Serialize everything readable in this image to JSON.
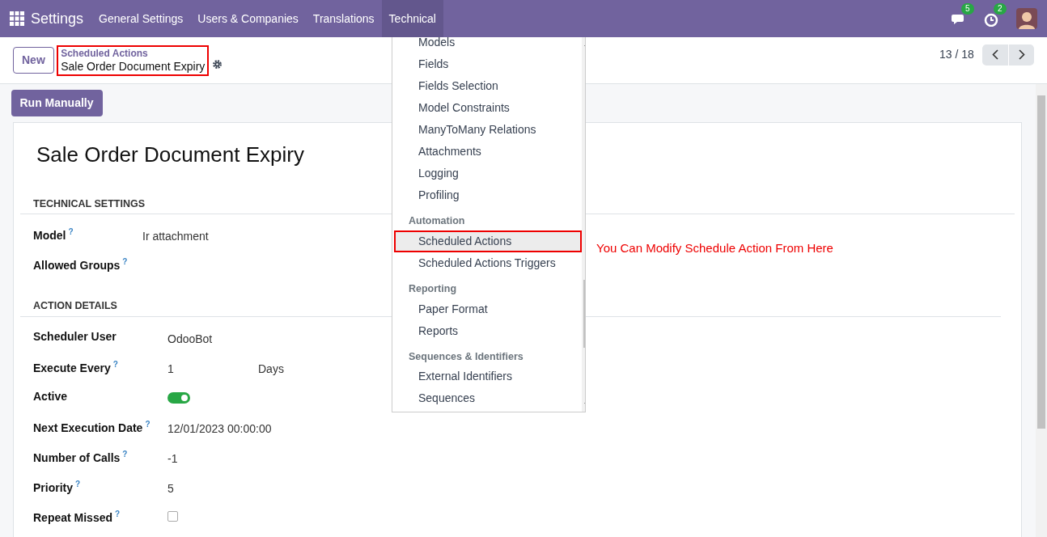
{
  "navbar": {
    "app": "Settings",
    "menus": [
      {
        "label": "General Settings",
        "selected": false
      },
      {
        "label": "Users & Companies",
        "selected": false
      },
      {
        "label": "Translations",
        "selected": false
      },
      {
        "label": "Technical",
        "selected": true
      }
    ],
    "indicators": [
      {
        "kind": "messages",
        "count": "5"
      },
      {
        "kind": "activities",
        "count": "2"
      }
    ]
  },
  "control_panel": {
    "new_button": "New",
    "breadcrumb": {
      "parent": "Scheduled Actions",
      "current": "Sale Order Document Expiry",
      "highlighted": true
    },
    "pager": "13 / 18"
  },
  "run_button": "Run Manually",
  "record": {
    "title": "Sale Order Document Expiry",
    "sections": [
      {
        "title": "TECHNICAL SETTINGS",
        "fields": [
          {
            "label": "Model",
            "help": "?",
            "kind": "text",
            "value": "Ir attachment"
          },
          {
            "label": "Allowed Groups",
            "help": "?",
            "kind": "text"
          }
        ]
      },
      {
        "title": "ACTION DETAILS",
        "fields": [
          {
            "label": "Scheduler User",
            "kind": "text",
            "value": "OdooBot"
          },
          {
            "label": "Execute Every",
            "help": "?",
            "kind": "interval",
            "value": "1",
            "unit": "Days"
          },
          {
            "label": "Active",
            "kind": "toggle",
            "on": true
          },
          {
            "label": "Next Execution Date",
            "help": "?",
            "kind": "text",
            "value": "12/01/2023 00:00:00"
          },
          {
            "label": "Number of Calls",
            "help": "?",
            "kind": "text",
            "value": "-1"
          },
          {
            "label": "Priority",
            "help": "?",
            "kind": "text",
            "value": "5"
          },
          {
            "label": "Repeat Missed",
            "help": "?",
            "kind": "checkbox",
            "checked": false
          }
        ]
      }
    ]
  },
  "dropdown": {
    "sections": [
      {
        "items": [
          {
            "label": "Models",
            "selected": false
          },
          {
            "label": "Fields",
            "selected": false
          },
          {
            "label": "Fields Selection",
            "selected": false
          },
          {
            "label": "Model Constraints",
            "selected": false
          },
          {
            "label": "ManyToMany Relations",
            "selected": false
          },
          {
            "label": "Attachments",
            "selected": false
          },
          {
            "label": "Logging",
            "selected": false
          },
          {
            "label": "Profiling",
            "selected": false
          }
        ]
      },
      {
        "header": "Automation",
        "items": [
          {
            "label": "Scheduled Actions",
            "selected": true
          },
          {
            "label": "Scheduled Actions Triggers",
            "selected": false
          }
        ]
      },
      {
        "header": "Reporting",
        "items": [
          {
            "label": "Paper Format",
            "selected": false
          },
          {
            "label": "Reports",
            "selected": false
          }
        ]
      },
      {
        "header": "Sequences & Identifiers",
        "items": [
          {
            "label": "External Identifiers",
            "selected": false
          },
          {
            "label": "Sequences",
            "selected": false
          }
        ]
      }
    ]
  },
  "annotation": "You Can Modify Schedule Action From Here"
}
